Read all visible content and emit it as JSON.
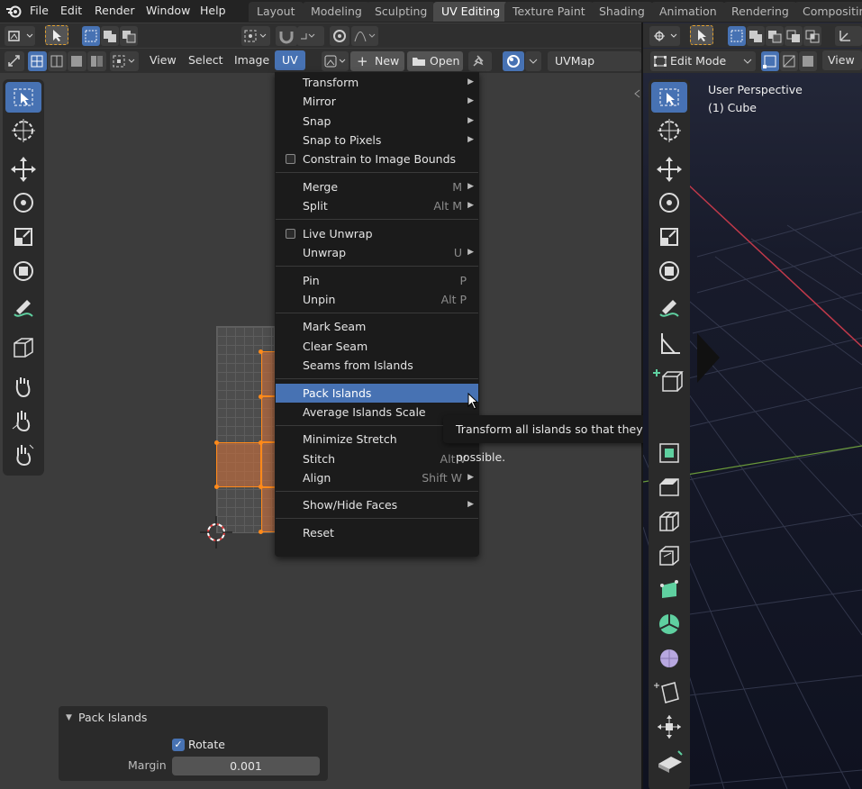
{
  "topbar": {
    "menu": [
      "File",
      "Edit",
      "Render",
      "Window",
      "Help"
    ],
    "workspaces": [
      {
        "label": "Layout",
        "active": false
      },
      {
        "label": "Modeling",
        "active": false
      },
      {
        "label": "Sculpting",
        "active": false
      },
      {
        "label": "UV Editing",
        "active": true
      },
      {
        "label": "Texture Paint",
        "active": false
      },
      {
        "label": "Shading",
        "active": false
      },
      {
        "label": "Animation",
        "active": false
      },
      {
        "label": "Rendering",
        "active": false
      },
      {
        "label": "Compositin",
        "active": false
      }
    ]
  },
  "uv_editor": {
    "header_menu": [
      "View",
      "Select",
      "Image",
      "UV"
    ],
    "new_label": "New",
    "open_label": "Open",
    "uvmap_label": "UVMap"
  },
  "uv_menu": {
    "items": [
      {
        "label": "Transform",
        "shortcut": "",
        "submenu": true,
        "checkbox": false
      },
      {
        "label": "Mirror",
        "shortcut": "",
        "submenu": true,
        "checkbox": false
      },
      {
        "label": "Snap",
        "shortcut": "",
        "submenu": true,
        "checkbox": false
      },
      {
        "label": "Snap to Pixels",
        "shortcut": "",
        "submenu": true,
        "checkbox": false
      },
      {
        "label": "Constrain to Image Bounds",
        "shortcut": "",
        "submenu": false,
        "checkbox": true
      },
      {
        "label": "Merge",
        "shortcut": "M",
        "submenu": true,
        "checkbox": false
      },
      {
        "label": "Split",
        "shortcut": "Alt M",
        "submenu": true,
        "checkbox": false
      },
      {
        "label": "Live Unwrap",
        "shortcut": "",
        "submenu": false,
        "checkbox": true
      },
      {
        "label": "Unwrap",
        "shortcut": "U",
        "submenu": true,
        "checkbox": false
      },
      {
        "label": "Pin",
        "shortcut": "P",
        "submenu": false,
        "checkbox": false
      },
      {
        "label": "Unpin",
        "shortcut": "Alt P",
        "submenu": false,
        "checkbox": false
      },
      {
        "label": "Mark Seam",
        "shortcut": "",
        "submenu": false,
        "checkbox": false
      },
      {
        "label": "Clear Seam",
        "shortcut": "",
        "submenu": false,
        "checkbox": false
      },
      {
        "label": "Seams from Islands",
        "shortcut": "",
        "submenu": false,
        "checkbox": false
      },
      {
        "label": "Pack Islands",
        "shortcut": "",
        "submenu": false,
        "checkbox": false,
        "highlighted": true
      },
      {
        "label": "Average Islands Scale",
        "shortcut": "",
        "submenu": false,
        "checkbox": false
      },
      {
        "label": "Minimize Stretch",
        "shortcut": "",
        "submenu": false,
        "checkbox": false
      },
      {
        "label": "Stitch",
        "shortcut": "Alt V",
        "submenu": false,
        "checkbox": false
      },
      {
        "label": "Align",
        "shortcut": "Shift W",
        "submenu": true,
        "checkbox": false
      },
      {
        "label": "Show/Hide Faces",
        "shortcut": "",
        "submenu": true,
        "checkbox": false
      },
      {
        "label": "Reset",
        "shortcut": "",
        "submenu": false,
        "checkbox": false
      }
    ]
  },
  "tooltip": {
    "text": "Transform all islands so that they fill up the UV space as much as possible."
  },
  "operator_panel": {
    "title": "Pack Islands",
    "rotate_label": "Rotate",
    "rotate_checked": true,
    "margin_label": "Margin",
    "margin_value": "0.001"
  },
  "viewport": {
    "mode_label": "Edit Mode",
    "view_label": "View",
    "perspective_label": "User Perspective",
    "object_label": "(1) Cube"
  },
  "colors": {
    "accent": "#4772b3",
    "selection_orange": "#ff8a1a",
    "header_bg": "#232323",
    "editor_bg": "#3c3c3c"
  }
}
